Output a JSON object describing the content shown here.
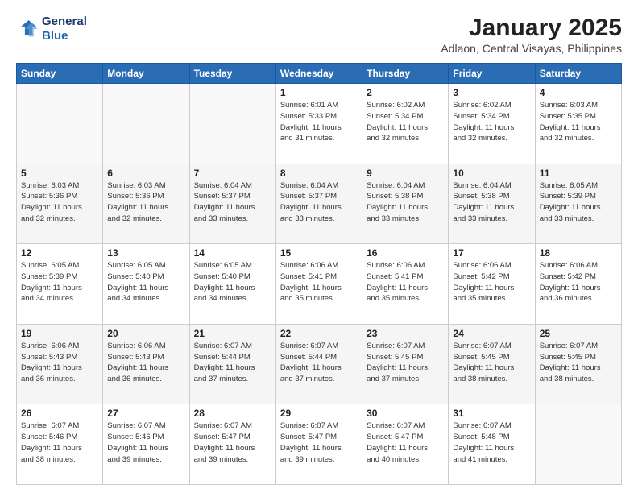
{
  "logo": {
    "line1": "General",
    "line2": "Blue"
  },
  "title": "January 2025",
  "subtitle": "Adlaon, Central Visayas, Philippines",
  "days_of_week": [
    "Sunday",
    "Monday",
    "Tuesday",
    "Wednesday",
    "Thursday",
    "Friday",
    "Saturday"
  ],
  "weeks": [
    [
      {
        "day": "",
        "info": ""
      },
      {
        "day": "",
        "info": ""
      },
      {
        "day": "",
        "info": ""
      },
      {
        "day": "1",
        "info": "Sunrise: 6:01 AM\nSunset: 5:33 PM\nDaylight: 11 hours\nand 31 minutes."
      },
      {
        "day": "2",
        "info": "Sunrise: 6:02 AM\nSunset: 5:34 PM\nDaylight: 11 hours\nand 32 minutes."
      },
      {
        "day": "3",
        "info": "Sunrise: 6:02 AM\nSunset: 5:34 PM\nDaylight: 11 hours\nand 32 minutes."
      },
      {
        "day": "4",
        "info": "Sunrise: 6:03 AM\nSunset: 5:35 PM\nDaylight: 11 hours\nand 32 minutes."
      }
    ],
    [
      {
        "day": "5",
        "info": "Sunrise: 6:03 AM\nSunset: 5:36 PM\nDaylight: 11 hours\nand 32 minutes."
      },
      {
        "day": "6",
        "info": "Sunrise: 6:03 AM\nSunset: 5:36 PM\nDaylight: 11 hours\nand 32 minutes."
      },
      {
        "day": "7",
        "info": "Sunrise: 6:04 AM\nSunset: 5:37 PM\nDaylight: 11 hours\nand 33 minutes."
      },
      {
        "day": "8",
        "info": "Sunrise: 6:04 AM\nSunset: 5:37 PM\nDaylight: 11 hours\nand 33 minutes."
      },
      {
        "day": "9",
        "info": "Sunrise: 6:04 AM\nSunset: 5:38 PM\nDaylight: 11 hours\nand 33 minutes."
      },
      {
        "day": "10",
        "info": "Sunrise: 6:04 AM\nSunset: 5:38 PM\nDaylight: 11 hours\nand 33 minutes."
      },
      {
        "day": "11",
        "info": "Sunrise: 6:05 AM\nSunset: 5:39 PM\nDaylight: 11 hours\nand 33 minutes."
      }
    ],
    [
      {
        "day": "12",
        "info": "Sunrise: 6:05 AM\nSunset: 5:39 PM\nDaylight: 11 hours\nand 34 minutes."
      },
      {
        "day": "13",
        "info": "Sunrise: 6:05 AM\nSunset: 5:40 PM\nDaylight: 11 hours\nand 34 minutes."
      },
      {
        "day": "14",
        "info": "Sunrise: 6:05 AM\nSunset: 5:40 PM\nDaylight: 11 hours\nand 34 minutes."
      },
      {
        "day": "15",
        "info": "Sunrise: 6:06 AM\nSunset: 5:41 PM\nDaylight: 11 hours\nand 35 minutes."
      },
      {
        "day": "16",
        "info": "Sunrise: 6:06 AM\nSunset: 5:41 PM\nDaylight: 11 hours\nand 35 minutes."
      },
      {
        "day": "17",
        "info": "Sunrise: 6:06 AM\nSunset: 5:42 PM\nDaylight: 11 hours\nand 35 minutes."
      },
      {
        "day": "18",
        "info": "Sunrise: 6:06 AM\nSunset: 5:42 PM\nDaylight: 11 hours\nand 36 minutes."
      }
    ],
    [
      {
        "day": "19",
        "info": "Sunrise: 6:06 AM\nSunset: 5:43 PM\nDaylight: 11 hours\nand 36 minutes."
      },
      {
        "day": "20",
        "info": "Sunrise: 6:06 AM\nSunset: 5:43 PM\nDaylight: 11 hours\nand 36 minutes."
      },
      {
        "day": "21",
        "info": "Sunrise: 6:07 AM\nSunset: 5:44 PM\nDaylight: 11 hours\nand 37 minutes."
      },
      {
        "day": "22",
        "info": "Sunrise: 6:07 AM\nSunset: 5:44 PM\nDaylight: 11 hours\nand 37 minutes."
      },
      {
        "day": "23",
        "info": "Sunrise: 6:07 AM\nSunset: 5:45 PM\nDaylight: 11 hours\nand 37 minutes."
      },
      {
        "day": "24",
        "info": "Sunrise: 6:07 AM\nSunset: 5:45 PM\nDaylight: 11 hours\nand 38 minutes."
      },
      {
        "day": "25",
        "info": "Sunrise: 6:07 AM\nSunset: 5:45 PM\nDaylight: 11 hours\nand 38 minutes."
      }
    ],
    [
      {
        "day": "26",
        "info": "Sunrise: 6:07 AM\nSunset: 5:46 PM\nDaylight: 11 hours\nand 38 minutes."
      },
      {
        "day": "27",
        "info": "Sunrise: 6:07 AM\nSunset: 5:46 PM\nDaylight: 11 hours\nand 39 minutes."
      },
      {
        "day": "28",
        "info": "Sunrise: 6:07 AM\nSunset: 5:47 PM\nDaylight: 11 hours\nand 39 minutes."
      },
      {
        "day": "29",
        "info": "Sunrise: 6:07 AM\nSunset: 5:47 PM\nDaylight: 11 hours\nand 39 minutes."
      },
      {
        "day": "30",
        "info": "Sunrise: 6:07 AM\nSunset: 5:47 PM\nDaylight: 11 hours\nand 40 minutes."
      },
      {
        "day": "31",
        "info": "Sunrise: 6:07 AM\nSunset: 5:48 PM\nDaylight: 11 hours\nand 41 minutes."
      },
      {
        "day": "",
        "info": ""
      }
    ]
  ],
  "colors": {
    "header_bg": "#2a6db5",
    "header_text": "#ffffff",
    "accent": "#2066b0"
  }
}
